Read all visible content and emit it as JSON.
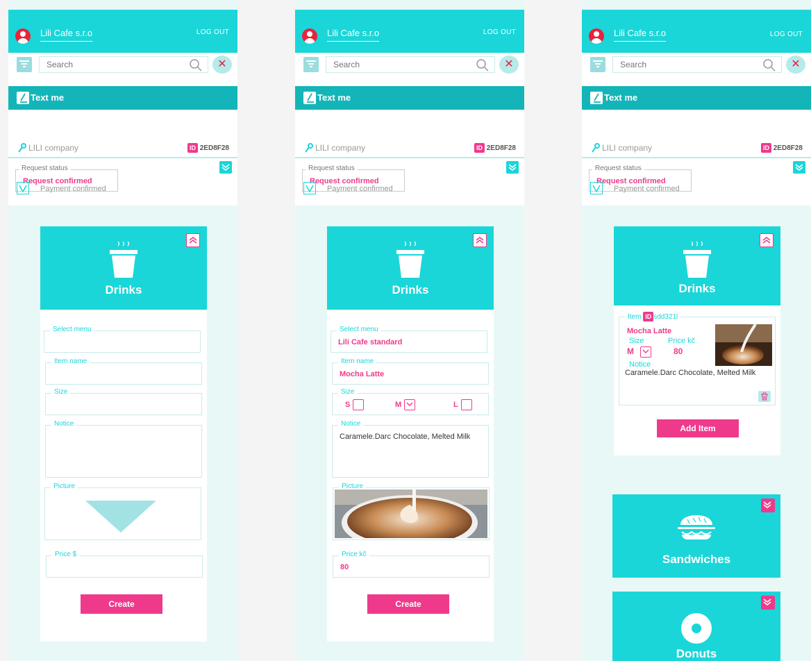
{
  "app": {
    "company": "Lili Cafe s.r.o",
    "logout": "LOG OUT",
    "search_placeholder": "Search",
    "text_me": "Text me"
  },
  "customer": {
    "name": "LILI company",
    "id_badge": "ID",
    "id_value": "2ED8F28"
  },
  "status": {
    "label": "Request status",
    "value": "Request confirmed",
    "payment_label": "Payment confirmed"
  },
  "screen1": {
    "category": "Drinks",
    "fields": {
      "select_menu": "Select menu",
      "item_name": "Item name",
      "size": "Size",
      "notice": "Notice",
      "picture": "Picture",
      "price": "Price $"
    },
    "create": "Create"
  },
  "screen2": {
    "category": "Drinks",
    "fields": {
      "select_menu": "Select menu",
      "select_menu_value": "Lili Cafe standard",
      "item_name": "Item name",
      "item_name_value": "Mocha Latte",
      "size": "Size",
      "size_s": "S",
      "size_m": "M",
      "size_l": "L",
      "notice": "Notice",
      "notice_value": "Caramele.Darc Chocolate, Melted Milk",
      "picture": "Picture",
      "price": "Price kč",
      "price_value": "80"
    },
    "create": "Create"
  },
  "screen3": {
    "category": "Drinks",
    "item": {
      "label": "Item",
      "id_badge": "ID",
      "id_value": "sdd321l",
      "name": "Mocha Latte",
      "size_label": "Size",
      "size_value": "M",
      "price_label": "Price kč",
      "price_value": "80",
      "notice_label": "Notice",
      "notice_value": "Caramele.Darc Chocolate, Melted Milk"
    },
    "add_item": "Add Item",
    "categories": [
      "Sandwiches",
      "Donuts"
    ]
  },
  "colors": {
    "teal": "#1ad6d8",
    "dark_teal": "#14b5b8",
    "pink": "#ef3a8c",
    "red": "#e8233a"
  }
}
